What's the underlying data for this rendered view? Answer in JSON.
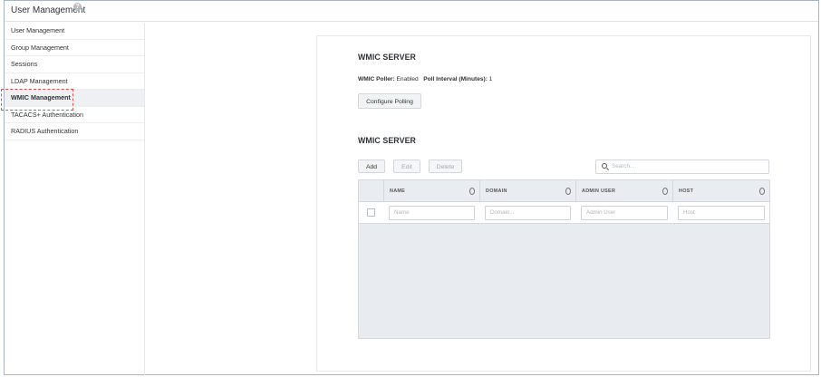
{
  "header": {
    "title": "User Management",
    "help_icon": "?"
  },
  "sidebar": {
    "items": [
      {
        "label": "User Management"
      },
      {
        "label": "Group Management"
      },
      {
        "label": "Sessions"
      },
      {
        "label": "LDAP Management"
      },
      {
        "label": "WMIC Management",
        "active": true
      },
      {
        "label": "TACACS+ Authentication"
      },
      {
        "label": "RADIUS Authentication"
      }
    ]
  },
  "poller": {
    "section_title": "WMIC SERVER",
    "poller_label": "WMIC Poller:",
    "poller_value": "Enabled",
    "interval_label": "Poll Interval (Minutes):",
    "interval_value": "1",
    "configure_button": "Configure Polling"
  },
  "servers": {
    "section_title": "WMIC SERVER",
    "toolbar": {
      "add": "Add",
      "edit": "Edit",
      "delete": "Delete"
    },
    "search_placeholder": "Search...",
    "columns": [
      "NAME",
      "DOMAIN",
      "ADMIN USER",
      "HOST"
    ],
    "filters": [
      "Name",
      "Domain...",
      "Admin User",
      "Host"
    ]
  },
  "colors": {
    "highlight": "#d9534f",
    "table_bg": "#e8ebef"
  }
}
